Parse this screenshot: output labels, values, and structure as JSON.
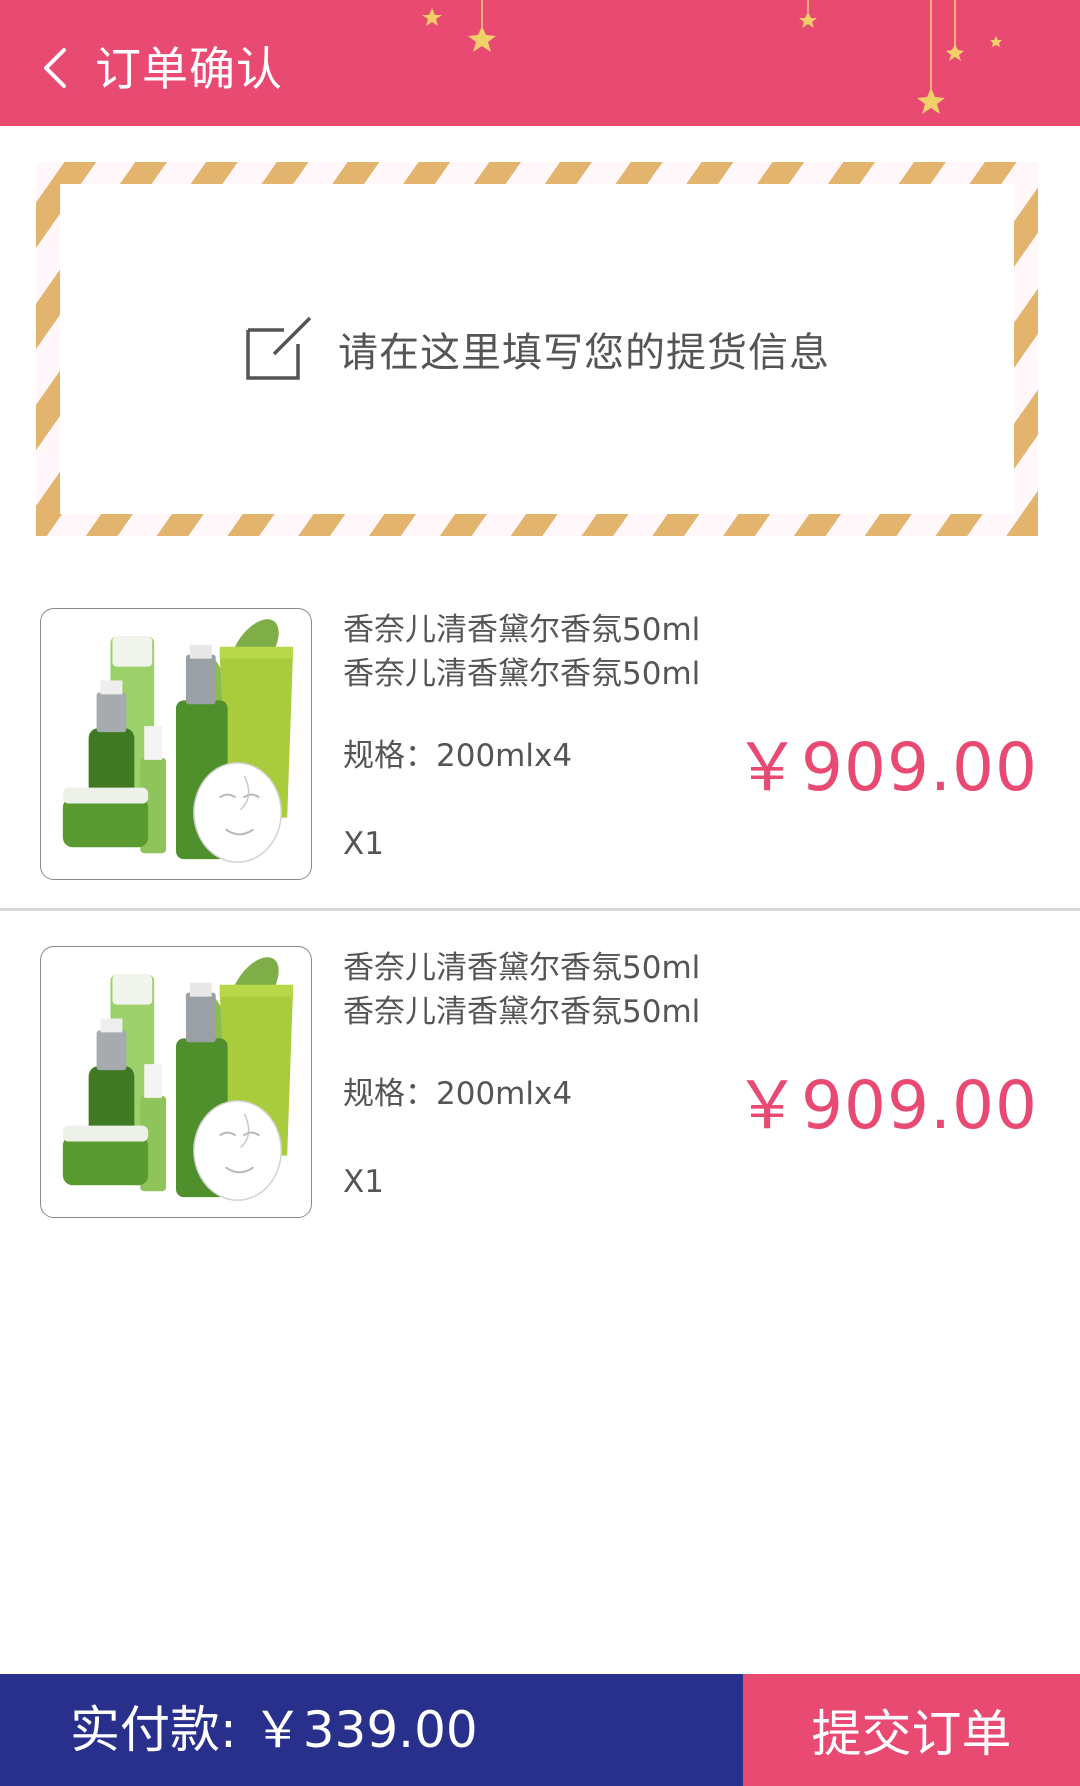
{
  "header": {
    "title": "订单确认",
    "back_icon": "chevron-left-icon",
    "bg_color": "#e84a72"
  },
  "address": {
    "placeholder": "请在这里填写您的提货信息",
    "icon": "edit-icon"
  },
  "products": [
    {
      "name_line1": "香奈儿清香黛尔香氛50ml",
      "name_line2": "香奈儿清香黛尔香氛50ml",
      "spec": "规格：200mlx4",
      "qty": "X1",
      "price": "￥909.00"
    },
    {
      "name_line1": "香奈儿清香黛尔香氛50ml",
      "name_line2": "香奈儿清香黛尔香氛50ml",
      "spec": "规格：200mlx4",
      "qty": "X1",
      "price": "￥909.00"
    }
  ],
  "footer": {
    "total": "实付款: ￥339.00",
    "submit_label": "提交订单",
    "total_bg": "#28308c",
    "submit_bg": "#e84a72"
  }
}
